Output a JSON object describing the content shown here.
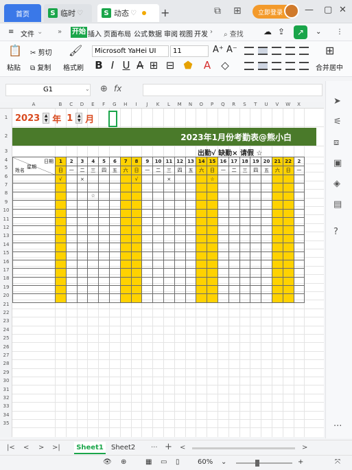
{
  "tabs": {
    "home": "首页",
    "file_tab": "临时",
    "active_tab": "动态"
  },
  "titlebar": {
    "login_label": "立即登录"
  },
  "menu": {
    "file": "文件",
    "items": [
      "开始",
      "插入",
      "页面布局",
      "公式",
      "数据",
      "审阅",
      "视图",
      "开发"
    ],
    "search": "查找"
  },
  "ribbon": {
    "paste": "粘贴",
    "cut": "剪切",
    "copy": "复制",
    "format_painter": "格式刷",
    "font_name": "Microsoft YaHei UI",
    "font_size": "11",
    "merge_center": "合并居中"
  },
  "formula_bar": {
    "cell_ref": "G1",
    "fx": "fx"
  },
  "sheet": {
    "columns": [
      "A",
      "B",
      "C",
      "D",
      "E",
      "F",
      "G",
      "H",
      "I",
      "J",
      "K",
      "L",
      "M",
      "N",
      "O",
      "P",
      "Q",
      "R",
      "S",
      "T",
      "U",
      "V",
      "W",
      "X"
    ],
    "year": "2023",
    "year_unit": "年",
    "month": "1",
    "month_unit": "月",
    "banner_title": "2023年1月份考勤表@熊小白",
    "legend": "出勤√ 缺勤× 请假 ☆",
    "header_date": "日期",
    "header_week": "星期",
    "header_name": "姓名",
    "dates": [
      "1",
      "2",
      "3",
      "4",
      "5",
      "6",
      "7",
      "8",
      "9",
      "10",
      "11",
      "12",
      "13",
      "14",
      "15",
      "16",
      "17",
      "18",
      "19",
      "20",
      "21",
      "22",
      "2"
    ],
    "weekdays": [
      "日",
      "一",
      "二",
      "三",
      "四",
      "五",
      "六",
      "日",
      "一",
      "二",
      "三",
      "四",
      "五",
      "六",
      "日",
      "一",
      "二",
      "三",
      "四",
      "五",
      "六",
      "日",
      "一"
    ],
    "weekend_columns": [
      0,
      6,
      7,
      13,
      14,
      20,
      21
    ],
    "marks": [
      {
        "row": 0,
        "col": 0,
        "text": "√"
      },
      {
        "row": 0,
        "col": 2,
        "text": "×"
      },
      {
        "row": 0,
        "col": 7,
        "text": "√"
      },
      {
        "row": 0,
        "col": 10,
        "text": "×"
      },
      {
        "row": 0,
        "col": 14,
        "text": "☆"
      },
      {
        "row": 2,
        "col": 3,
        "text": "☆"
      }
    ],
    "data_row_count": 15
  },
  "sheet_tabs": {
    "sheet1": "Sheet1",
    "sheet2": "Sheet2",
    "more": "···",
    "add": "+"
  },
  "status": {
    "zoom": "60%"
  }
}
